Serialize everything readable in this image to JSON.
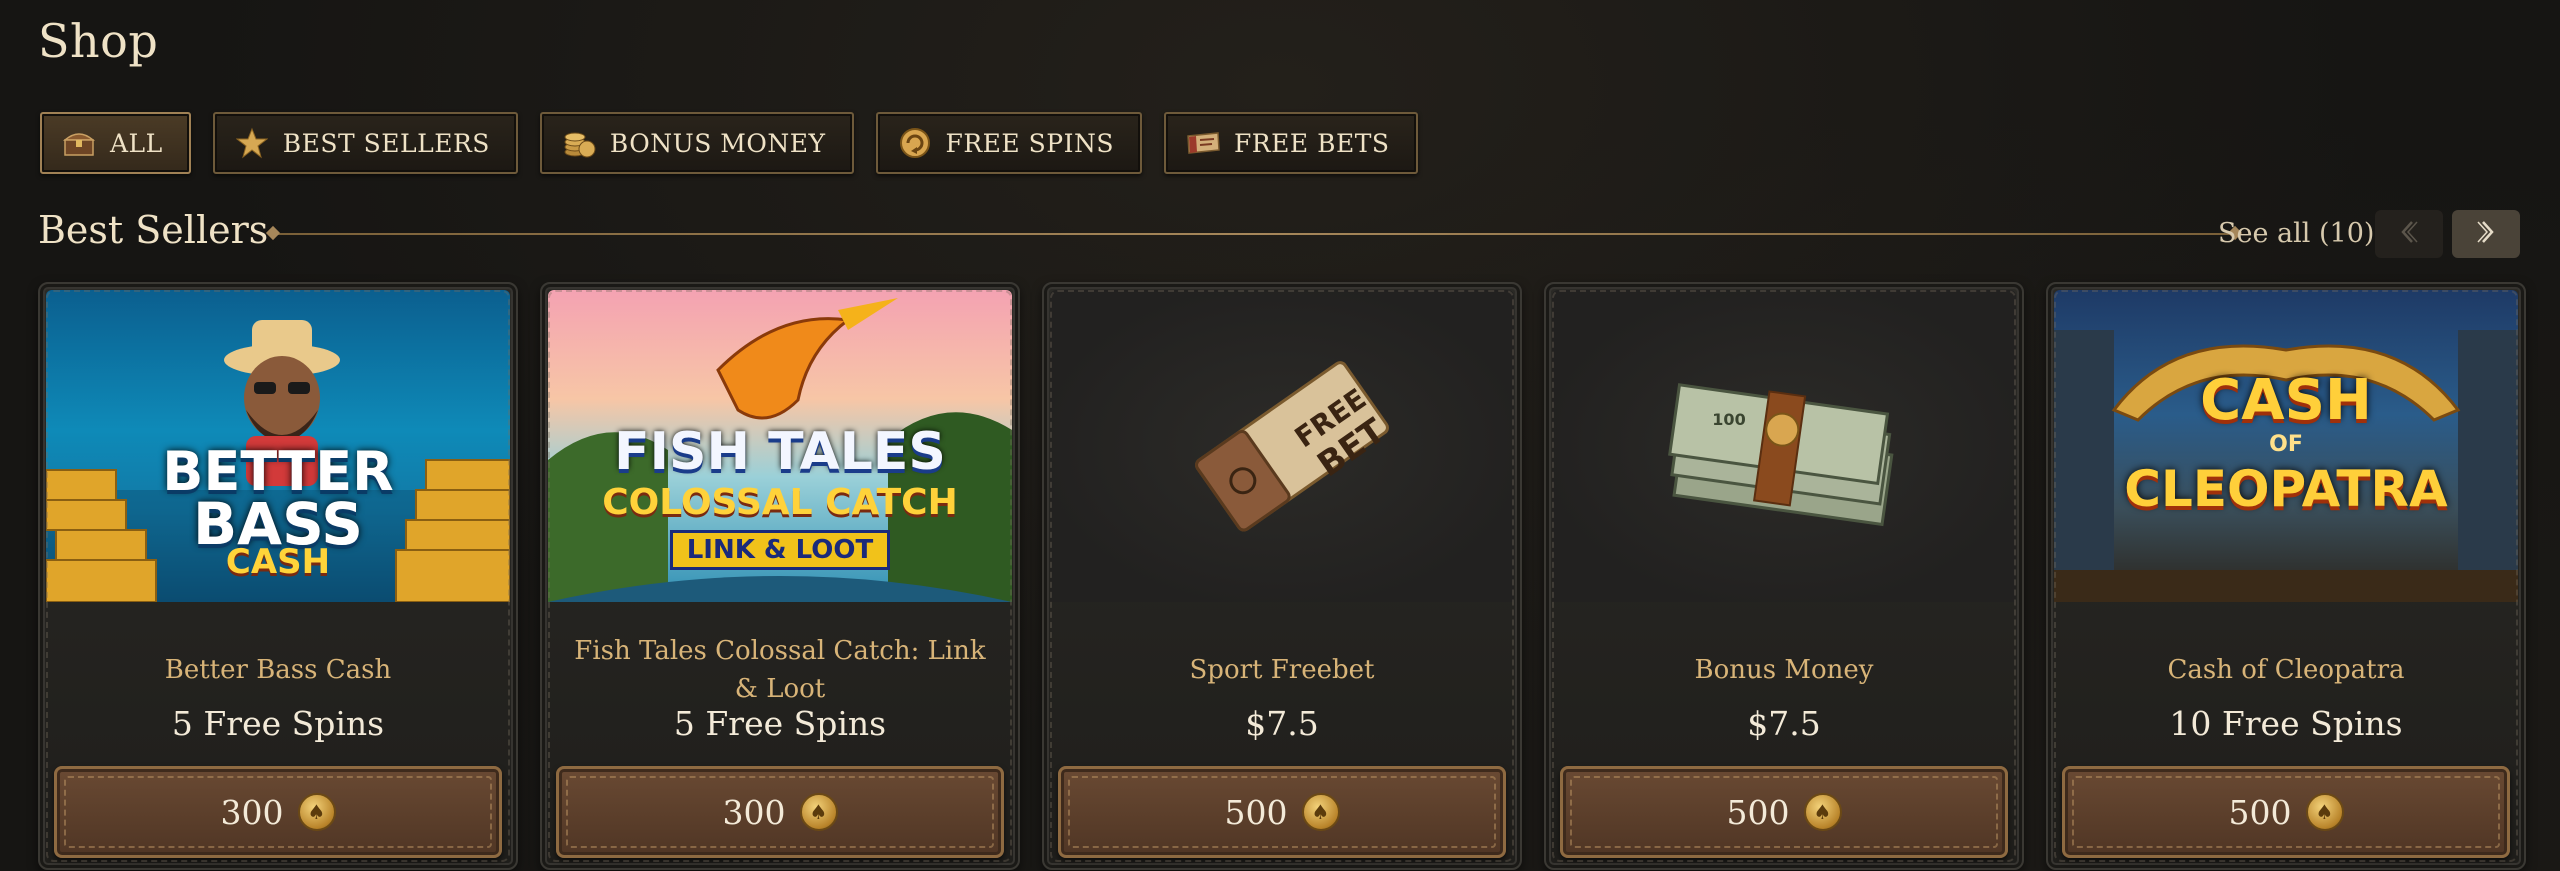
{
  "page": {
    "title": "Shop"
  },
  "filters": [
    {
      "label": "ALL",
      "icon": "treasure-chest-icon",
      "active": true
    },
    {
      "label": "BEST SELLERS",
      "icon": "star-icon",
      "active": false
    },
    {
      "label": "BONUS MONEY",
      "icon": "coins-icon",
      "active": false
    },
    {
      "label": "FREE SPINS",
      "icon": "spin-coin-icon",
      "active": false
    },
    {
      "label": "FREE BETS",
      "icon": "ticket-icon",
      "active": false
    }
  ],
  "section": {
    "title": "Best Sellers",
    "see_all": "See all (10)"
  },
  "cards": [
    {
      "name": "Better Bass Cash",
      "value": "5 Free Spins",
      "price": "300",
      "art": {
        "line1": "BETTER",
        "line2": "BASS",
        "line3": "CASH"
      }
    },
    {
      "name": "Fish Tales Colossal Catch: Link & Loot",
      "value": "5 Free Spins",
      "price": "300",
      "art": {
        "line1": "FISH TALES",
        "line2": "COLOSSAL CATCH",
        "line3": "LINK & LOOT"
      }
    },
    {
      "name": "Sport Freebet",
      "value": "$7.5",
      "price": "500",
      "art": {
        "line1": "FREE",
        "line2": "BET"
      }
    },
    {
      "name": "Bonus Money",
      "value": "$7.5",
      "price": "500",
      "art": {
        "line1": "100"
      }
    },
    {
      "name": "Cash of Cleopatra",
      "value": "10 Free Spins",
      "price": "500",
      "art": {
        "line1": "CASH",
        "line2": "OF",
        "line3": "CLEOPATRA"
      }
    }
  ],
  "colors": {
    "accent_gold": "#d8b478",
    "button_brown": "#5c3f2b",
    "background": "#161513"
  }
}
